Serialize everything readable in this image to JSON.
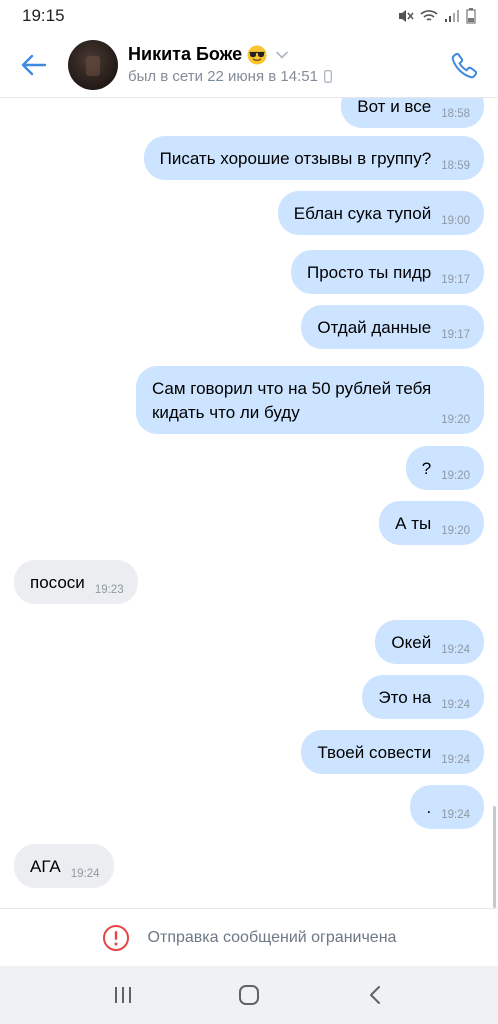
{
  "status_bar": {
    "time": "19:15"
  },
  "header": {
    "contact_name": "Никита Боже",
    "last_seen": "был в сети 22 июня в 14:51"
  },
  "messages": [
    {
      "dir": "out",
      "text": "Вот и все",
      "time": "18:58"
    },
    {
      "dir": "out",
      "text": "Писать хорошие отзывы в группу?",
      "time": "18:59"
    },
    {
      "dir": "out",
      "text": "Еблан сука тупой",
      "time": "19:00"
    },
    {
      "dir": "out",
      "text": "Просто ты пидр",
      "time": "19:17"
    },
    {
      "dir": "out",
      "text": "Отдай данные",
      "time": "19:17"
    },
    {
      "dir": "out",
      "text": "Сам говорил что на 50 рублей тебя\nкидать что ли буду",
      "time": "19:20"
    },
    {
      "dir": "out",
      "text": "?",
      "time": "19:20"
    },
    {
      "dir": "out",
      "text": "А ты",
      "time": "19:20"
    },
    {
      "dir": "in",
      "text": "пососи",
      "time": "19:23"
    },
    {
      "dir": "out",
      "text": "Окей",
      "time": "19:24"
    },
    {
      "dir": "out",
      "text": "Это на",
      "time": "19:24"
    },
    {
      "dir": "out",
      "text": "Твоей совести",
      "time": "19:24"
    },
    {
      "dir": "out",
      "text": ".",
      "time": "19:24"
    },
    {
      "dir": "in",
      "text": "АГА",
      "time": "19:24"
    }
  ],
  "restriction": {
    "text": "Отправка сообщений ограничена"
  },
  "icons": {
    "back": "arrow-left-icon",
    "call": "phone-icon",
    "status": [
      "mute-icon",
      "wifi-icon",
      "signal-icon",
      "battery-icon"
    ],
    "nav": [
      "recent-apps-icon",
      "home-icon",
      "back-icon"
    ]
  },
  "colors": {
    "accent": "#3f8ae0",
    "outgoing_bubble": "#cce4ff",
    "incoming_bubble": "#ebedf0",
    "warning": "#e64646"
  }
}
